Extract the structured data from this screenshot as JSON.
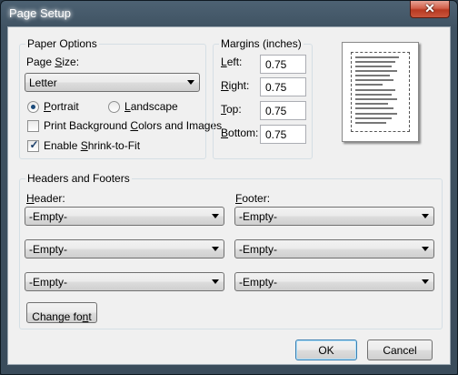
{
  "window": {
    "title": "Page Setup",
    "close_glyph": "✕"
  },
  "paper_options": {
    "group_label": "Paper Options",
    "page_size_label_pre": "Page ",
    "page_size_label_u": "S",
    "page_size_label_post": "ize:",
    "page_size_value": "Letter",
    "portrait_pre": "",
    "portrait_u": "P",
    "portrait_post": "ortrait",
    "landscape_pre": "",
    "landscape_u": "L",
    "landscape_post": "andscape",
    "print_bg_pre": "Print Background ",
    "print_bg_u": "C",
    "print_bg_post": "olors and Images",
    "shrink_pre": "Enable ",
    "shrink_u": "S",
    "shrink_post": "hrink-to-Fit",
    "shrink_check": "✓"
  },
  "margins": {
    "group_label": "Margins (inches)",
    "left_u": "L",
    "left_post": "eft:",
    "left_value": "0.75",
    "right_u": "R",
    "right_post": "ight:",
    "right_value": "0.75",
    "top_u": "T",
    "top_post": "op:",
    "top_value": "0.75",
    "bottom_u": "B",
    "bottom_post": "ottom:",
    "bottom_value": "0.75"
  },
  "headers_footers": {
    "group_label": "Headers and Footers",
    "header_u": "H",
    "header_post": "eader:",
    "footer_u": "F",
    "footer_post": "ooter:",
    "header_values": [
      "-Empty-",
      "-Empty-",
      "-Empty-"
    ],
    "footer_values": [
      "-Empty-",
      "-Empty-",
      "-Empty-"
    ],
    "change_font_pre": "Change fo",
    "change_font_u": "n",
    "change_font_post": "t"
  },
  "buttons": {
    "ok": "OK",
    "cancel": "Cancel"
  }
}
